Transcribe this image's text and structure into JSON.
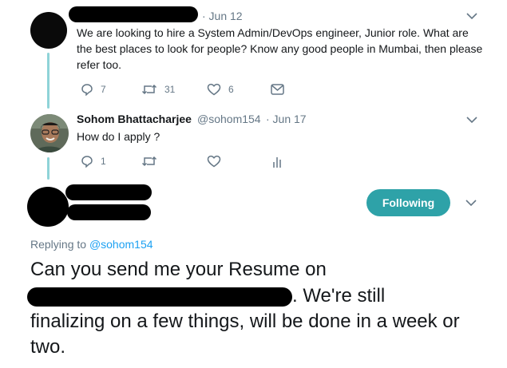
{
  "tweet1": {
    "date": "· Jun 12",
    "text": "We are looking to hire a System Admin/DevOps engineer, Junior role. What are the best places to look for people? Know any good people in Mumbai, then please refer too.",
    "reply_count": "7",
    "retweet_count": "31",
    "like_count": "6"
  },
  "tweet2": {
    "display_name": "Sohom Bhattacharjee",
    "handle": "@sohom154",
    "date": "· Jun 17",
    "text": "How do I apply ?",
    "reply_count": "1"
  },
  "main_tweet": {
    "follow_label": "Following",
    "replying_prefix": "Replying to",
    "replying_handle": "@sohom154",
    "text_part1": "Can you send me your Resume on",
    "text_part2": ". We're still",
    "text_part3": "finalizing on a few things, will be done in a week or two."
  },
  "colors": {
    "accent": "#2ea2a8",
    "thread_line": "#8fd3d8",
    "meta": "#657786",
    "link": "#1da1f2"
  },
  "icons": [
    "reply-icon",
    "retweet-icon",
    "like-icon",
    "direct-message-icon",
    "analytics-icon",
    "chevron-down-icon"
  ]
}
